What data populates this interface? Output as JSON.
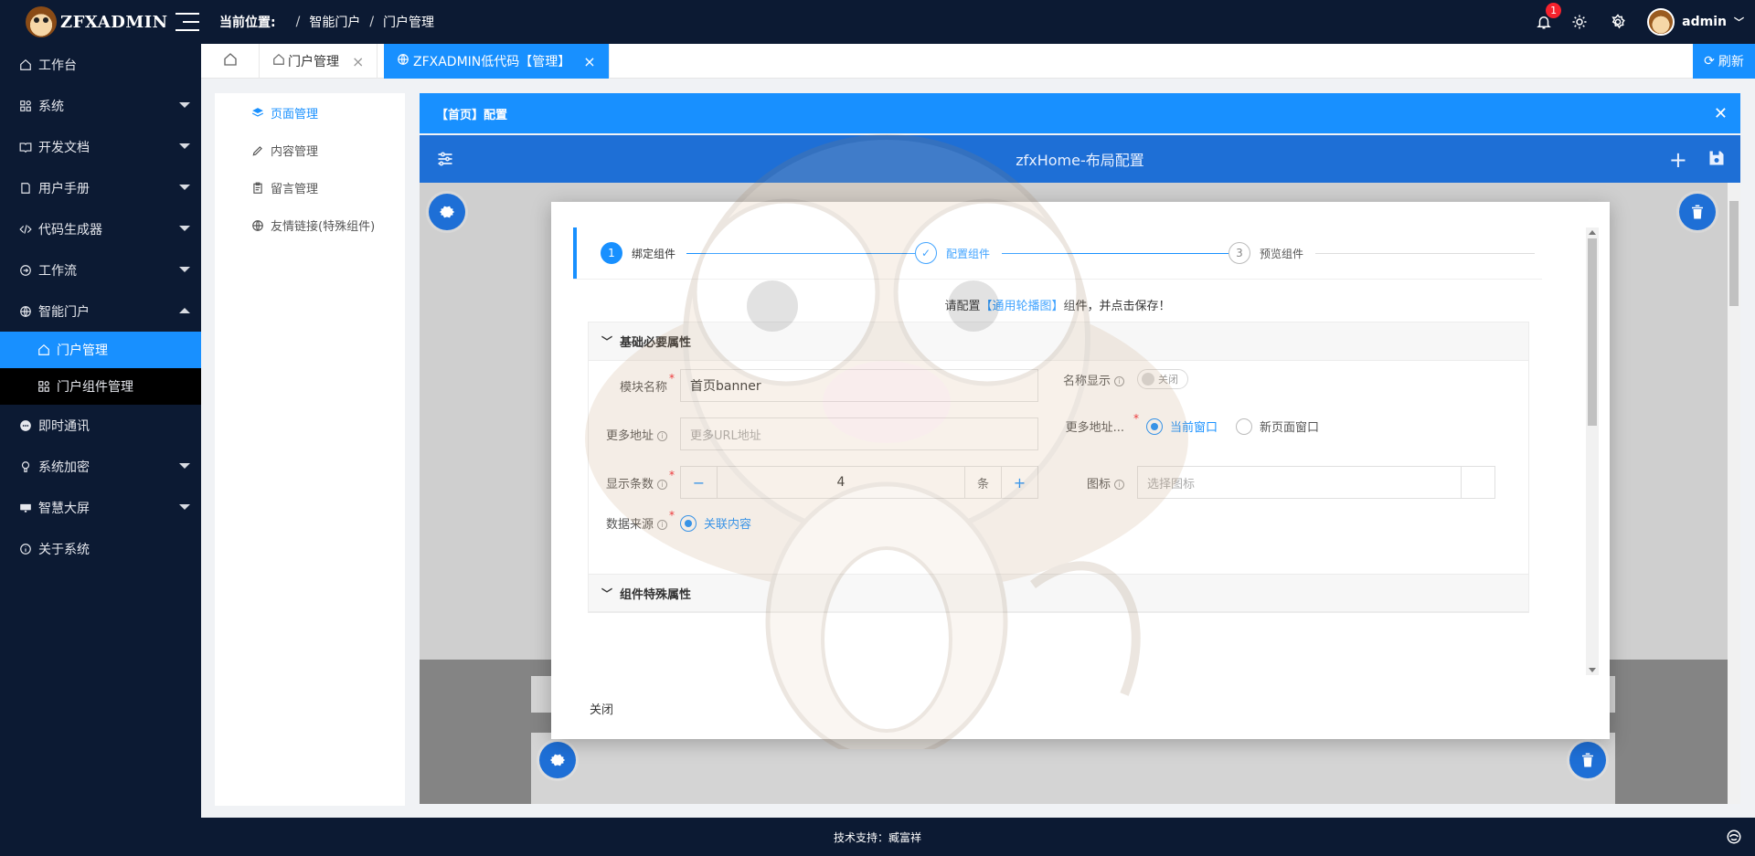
{
  "app": {
    "logo_text": "ZFXADMIN"
  },
  "breadcrumb": {
    "label": "当前位置:",
    "items": [
      "智能门户",
      "门户管理"
    ]
  },
  "topbar": {
    "notification_count": "1",
    "username": "admin"
  },
  "sidebar": {
    "items": [
      {
        "label": "工作台",
        "icon": "home-icon"
      },
      {
        "label": "系统",
        "icon": "apps-icon"
      },
      {
        "label": "开发文档",
        "icon": "book-icon"
      },
      {
        "label": "用户手册",
        "icon": "doc-icon"
      },
      {
        "label": "代码生成器",
        "icon": "code-icon"
      },
      {
        "label": "工作流",
        "icon": "flow-icon"
      },
      {
        "label": "智能门户",
        "icon": "globe-icon"
      },
      {
        "label": "即时通讯",
        "icon": "chat-icon"
      },
      {
        "label": "系统加密",
        "icon": "bulb-icon"
      },
      {
        "label": "智慧大屏",
        "icon": "monitor-icon"
      },
      {
        "label": "关于系统",
        "icon": "info-icon"
      }
    ],
    "sub_items": [
      {
        "label": "门户管理",
        "icon": "home-icon"
      },
      {
        "label": "门户组件管理",
        "icon": "apps-icon"
      }
    ]
  },
  "tabs": {
    "items": [
      {
        "label": "门户管理"
      },
      {
        "label": "ZFXADMIN低代码【管理】"
      }
    ],
    "refresh_label": "刷新"
  },
  "leftnav": {
    "items": [
      {
        "label": "页面管理"
      },
      {
        "label": "内容管理"
      },
      {
        "label": "留言管理"
      },
      {
        "label": "友情链接(特殊组件)"
      }
    ]
  },
  "config": {
    "header_title": "【首页】配置",
    "layout_title": "zfxHome-布局配置"
  },
  "modal": {
    "steps": [
      {
        "num": "1",
        "label": "绑定组件"
      },
      {
        "label": "配置组件"
      },
      {
        "num": "3",
        "label": "预览组件"
      }
    ],
    "tip_prefix": "请配置",
    "tip_component": "【通用轮播图】",
    "tip_suffix": "组件，并点击保存！",
    "section_basic": "基础必要属性",
    "section_special": "组件特殊属性",
    "fields": {
      "module_name_label": "模块名称",
      "module_name_value": "首页banner",
      "name_display_label": "名称显示",
      "name_display_toggle": "关闭",
      "more_url_label": "更多地址",
      "more_url_placeholder": "更多URL地址",
      "more_url_open_label": "更多地址...",
      "open_current": "当前窗口",
      "open_new": "新页面窗口",
      "display_count_label": "显示条数",
      "display_count_value": "4",
      "display_count_unit": "条",
      "icon_label": "图标",
      "icon_placeholder": "选择图标",
      "source_label": "数据来源",
      "source_option": "关联内容"
    },
    "close_label": "关闭"
  },
  "footer": {
    "text": "技术支持：臧富祥"
  },
  "colors": {
    "primary": "#1890ff",
    "dark": "#0c1a33",
    "layout_bar": "#1e6fd6"
  }
}
